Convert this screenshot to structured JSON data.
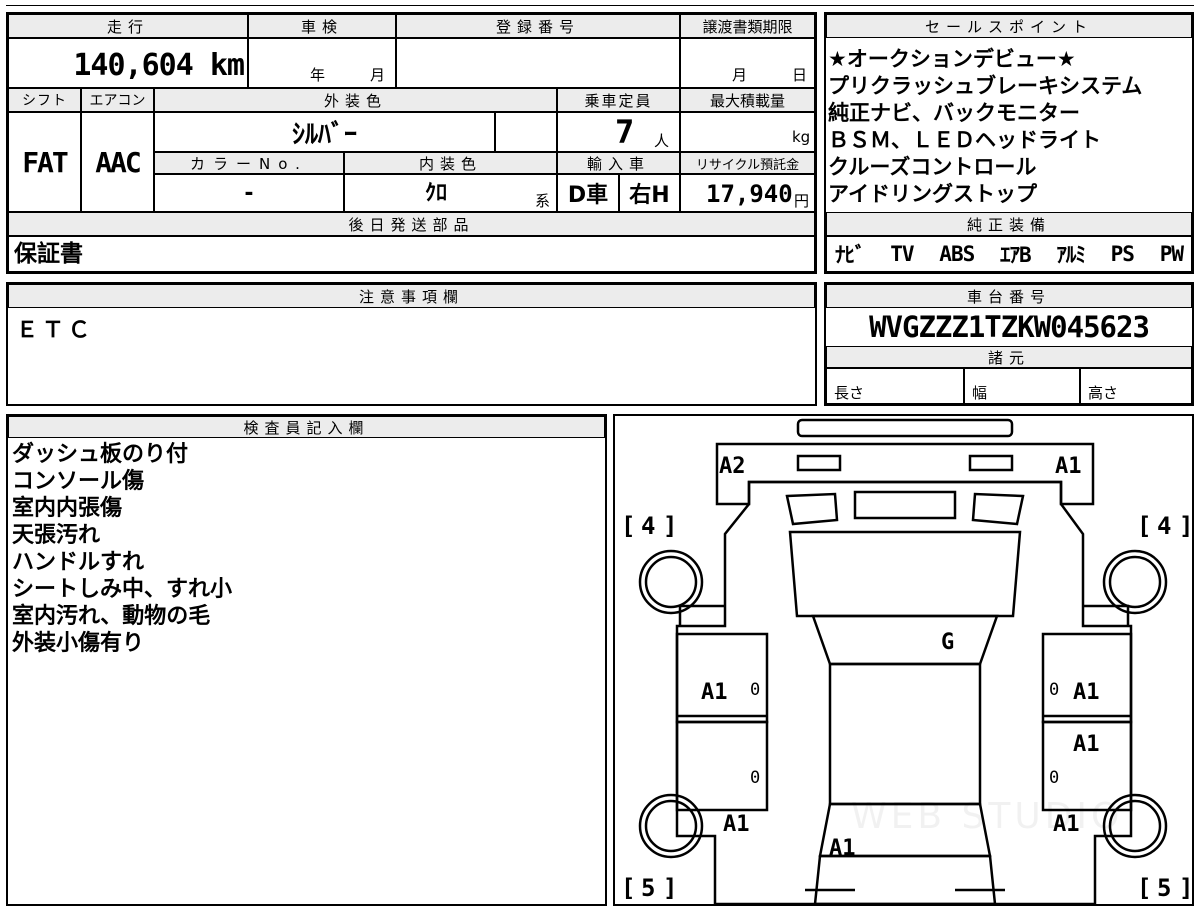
{
  "main_table": {
    "mileage_label": "走行",
    "mileage_value": "140,604 km",
    "inspection_label": "車検",
    "inspection_year": "年",
    "inspection_month": "月",
    "registration_label": "登録番号",
    "transfer_label": "譲渡書類期限",
    "transfer_month": "月",
    "transfer_day": "日",
    "shift_label": "シフト",
    "shift_value": "FAT",
    "aircon_label": "エアコン",
    "aircon_value": "AAC",
    "exterior_label": "外装色",
    "exterior_value": "ｼﾙﾊﾞｰ",
    "capacity_label": "乗車定員",
    "capacity_value": "7",
    "capacity_unit": "人",
    "maxload_label": "最大積載量",
    "maxload_unit": "kg",
    "color_no_label": "カラーNo.",
    "color_no_value": "-",
    "interior_label": "内装色",
    "interior_value": "ｸﾛ",
    "interior_suffix": "系",
    "import_label": "輸入車",
    "import_value": "D車",
    "steering_value": "右H",
    "recycle_label": "リサイクル預託金",
    "recycle_value": "17,940",
    "recycle_unit": "円",
    "later_parts_label": "後日発送部品",
    "later_parts_value": "保証書"
  },
  "sales": {
    "label": "セールスポイント",
    "lines": [
      "★オークションデビュー★",
      "プリクラッシュブレーキシステム",
      "純正ナビ、バックモニター",
      "ＢＳＭ、ＬＥＤヘッドライト",
      "クルーズコントロール",
      "アイドリングストップ"
    ]
  },
  "equipment": {
    "label": "純正装備",
    "items": [
      "ﾅﾋﾞ",
      "TV",
      "ABS",
      "ｴｱB",
      "ｱﾙﾐ",
      "PS",
      "PW"
    ]
  },
  "notice": {
    "label": "注意事項欄",
    "value": "ＥＴＣ"
  },
  "chassis": {
    "label": "車台番号",
    "value": "WVGZZZ1TZKW045623"
  },
  "specs": {
    "label": "諸元",
    "length": "長さ",
    "width": "幅",
    "height": "高さ"
  },
  "inspector": {
    "label": "検査員記入欄",
    "lines": [
      "ダッシュ板のり付",
      "コンソール傷",
      "室内内張傷",
      "天張汚れ",
      "ハンドルすれ",
      "シートしみ中、すれ小",
      "室内汚れ、動物の毛",
      "外装小傷有り"
    ]
  },
  "diagram": {
    "front_left": "A2",
    "front_right": "A1",
    "roof": "G",
    "left_front_door": "A1",
    "right_front_door": "A1",
    "right_rear_door": "A1",
    "left_rear_quarter": "A1",
    "right_rear_quarter": "A1",
    "rear": "A1",
    "zero": "0",
    "tire_front_left": "4",
    "tire_front_right": "4",
    "tire_rear_left": "5",
    "tire_rear_right": "5",
    "bracket_open": "[",
    "bracket_close": "]",
    "watermark": "WEB STUDIO"
  }
}
